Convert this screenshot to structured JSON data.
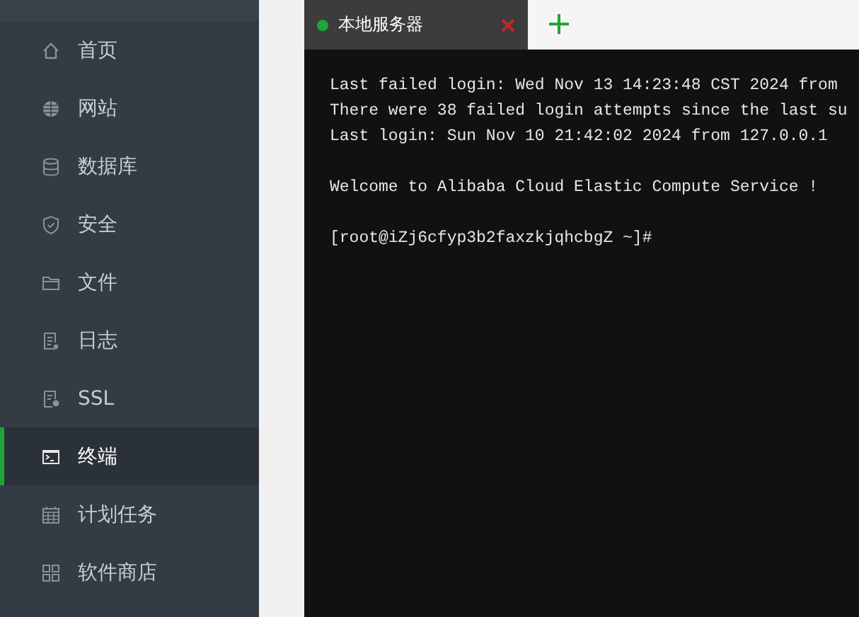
{
  "sidebar": {
    "items": [
      {
        "label": "首页",
        "selected": false
      },
      {
        "label": "网站",
        "selected": false
      },
      {
        "label": "数据库",
        "selected": false
      },
      {
        "label": "安全",
        "selected": false
      },
      {
        "label": "文件",
        "selected": false
      },
      {
        "label": "日志",
        "selected": false
      },
      {
        "label": "SSL",
        "selected": false
      },
      {
        "label": "终端",
        "selected": true
      },
      {
        "label": "计划任务",
        "selected": false
      },
      {
        "label": "软件商店",
        "selected": false
      }
    ]
  },
  "tabs": [
    {
      "label": "本地服务器",
      "selected": true,
      "connected": true
    }
  ],
  "terminal": {
    "paragraphs": [
      [
        "Last failed login: Wed Nov 13 14:23:48 CST 2024 from",
        "There were 38 failed login attempts since the last su",
        "Last login: Sun Nov 10 21:42:02 2024 from 127.0.0.1"
      ],
      [
        "Welcome to Alibaba Cloud Elastic Compute Service !"
      ],
      [
        "[root@iZj6cfyp3b2faxzkjqhcbgZ ~]#"
      ]
    ]
  }
}
